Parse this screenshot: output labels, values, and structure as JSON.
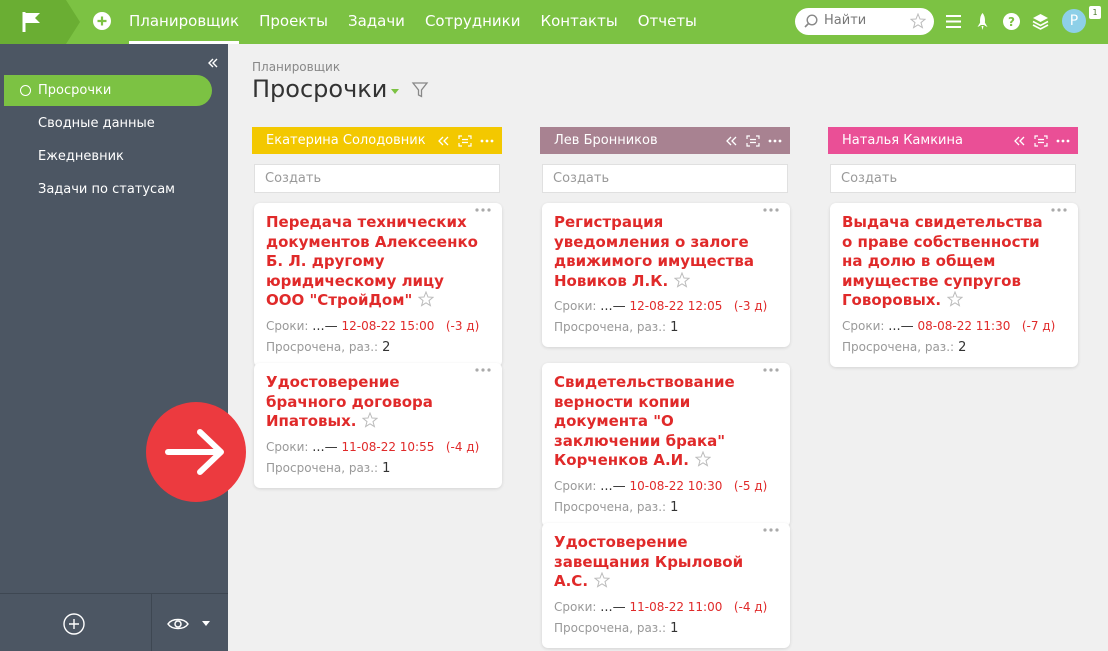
{
  "topbar": {
    "nav": [
      "Планировщик",
      "Проекты",
      "Задачи",
      "Сотрудники",
      "Контакты",
      "Отчеты"
    ],
    "active_index": 0,
    "search_placeholder": "Найти",
    "avatar_letter": "P",
    "avatar_badge": "1",
    "accent_color": "#7cc243"
  },
  "sidebar": {
    "items": [
      "Просрочки",
      "Сводные данные",
      "Ежедневник",
      "Задачи по статусам"
    ],
    "active_index": 0
  },
  "main": {
    "breadcrumb": "Планировщик",
    "title": "Просрочки"
  },
  "labels": {
    "create": "Создать",
    "deadline": "Сроки:",
    "deadline_start": "...—",
    "overdue_count": "Просрочена, раз.:"
  },
  "columns": [
    {
      "name": "Екатерина Солодовник",
      "color": "#f3c800",
      "cards": [
        {
          "title": "Передача технических документов Алексеенко Б. Л. другому юридическому лицу ООО \"СтройДом\"",
          "deadline": "12-08-22 15:00",
          "delay": "(-3 д)",
          "overdue": "2"
        },
        {
          "title": "Удостоверение брачного договора Ипатовых.",
          "deadline": "11-08-22 10:55",
          "delay": "(-4 д)",
          "overdue": "1"
        }
      ]
    },
    {
      "name": "Лев Бронников",
      "color": "#a88291",
      "cards": [
        {
          "title": "Регистрация уведомления о залоге движимого имущества Новиков Л.К.",
          "deadline": "12-08-22 12:05",
          "delay": "(-3 д)",
          "overdue": "1"
        },
        {
          "title": "Свидетельствование верности копии документа \"О заключении брака\" Корченков А.И.",
          "deadline": "10-08-22 10:30",
          "delay": "(-5 д)",
          "overdue": "1"
        },
        {
          "title": "Удостоверение завещания Крыловой А.С.",
          "deadline": "11-08-22 11:00",
          "delay": "(-4 д)",
          "overdue": "1"
        }
      ]
    },
    {
      "name": "Наталья Камкина",
      "color": "#ea4f96",
      "cards": [
        {
          "title": "Выдача свидетельства о праве собственности на долю в общем имуществе супругов Говоровых.",
          "deadline": "08-08-22 11:30",
          "delay": "(-7 д)",
          "overdue": "2"
        }
      ]
    }
  ]
}
